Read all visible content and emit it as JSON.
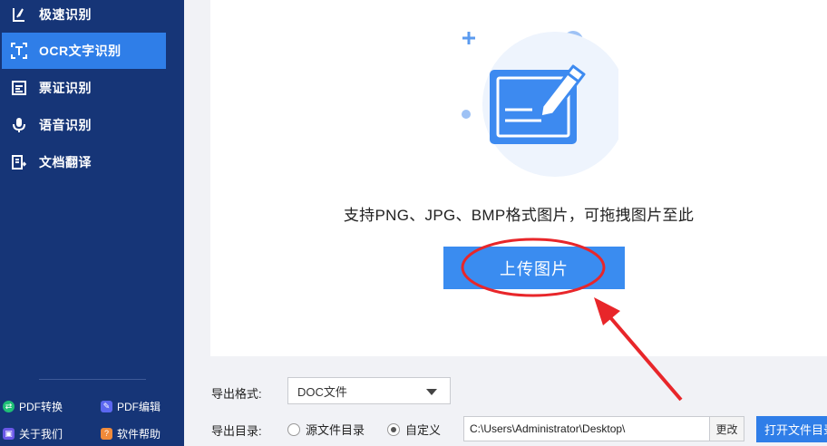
{
  "sidebar": {
    "items": [
      {
        "label": "极速识别",
        "icon": "fast-recognize-icon"
      },
      {
        "label": "OCR文字识别",
        "icon": "ocr-text-icon",
        "active": true
      },
      {
        "label": "票证识别",
        "icon": "ticket-icon"
      },
      {
        "label": "语音识别",
        "icon": "microphone-icon"
      },
      {
        "label": "文档翻译",
        "icon": "document-translate-icon"
      }
    ],
    "footer": {
      "pdf_convert": "PDF转换",
      "pdf_edit": "PDF编辑",
      "about": "关于我们",
      "help": "软件帮助"
    }
  },
  "main": {
    "support_text": "支持PNG、JPG、BMP格式图片，可拖拽图片至此",
    "upload_label": "上传图片"
  },
  "export": {
    "format_label": "导出格式:",
    "format_value": "DOC文件",
    "dir_label": "导出目录:",
    "radio_source": "源文件目录",
    "radio_custom": "自定义",
    "selected": "custom",
    "path_value": "C:\\Users\\Administrator\\Desktop\\",
    "change_label": "更改",
    "open_folder_label": "打开文件目录"
  },
  "colors": {
    "sidebar_bg": "#163577",
    "accent": "#2f7ee8",
    "upload_btn": "#3a8cf0",
    "annotation_red": "#e8262a"
  }
}
